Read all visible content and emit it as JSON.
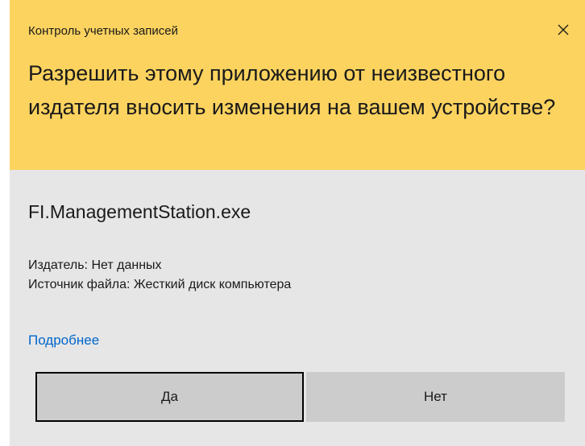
{
  "dialog": {
    "caption": "Контроль учетных записей",
    "close_icon": "close-icon",
    "question": "Разрешить этому приложению от неизвестного издателя вносить изменения на вашем устройстве?",
    "app_name": "FI.ManagementStation.exe",
    "publisher": "Издатель: Нет данных",
    "source": "Источник файла: Жесткий диск компьютера",
    "more_link": "Подробнее",
    "yes_label": "Да",
    "no_label": "Нет"
  },
  "colors": {
    "header_bg": "#fcd35f",
    "body_bg": "#e6e6e6",
    "button_bg": "#cccccc",
    "link": "#0066cc"
  }
}
